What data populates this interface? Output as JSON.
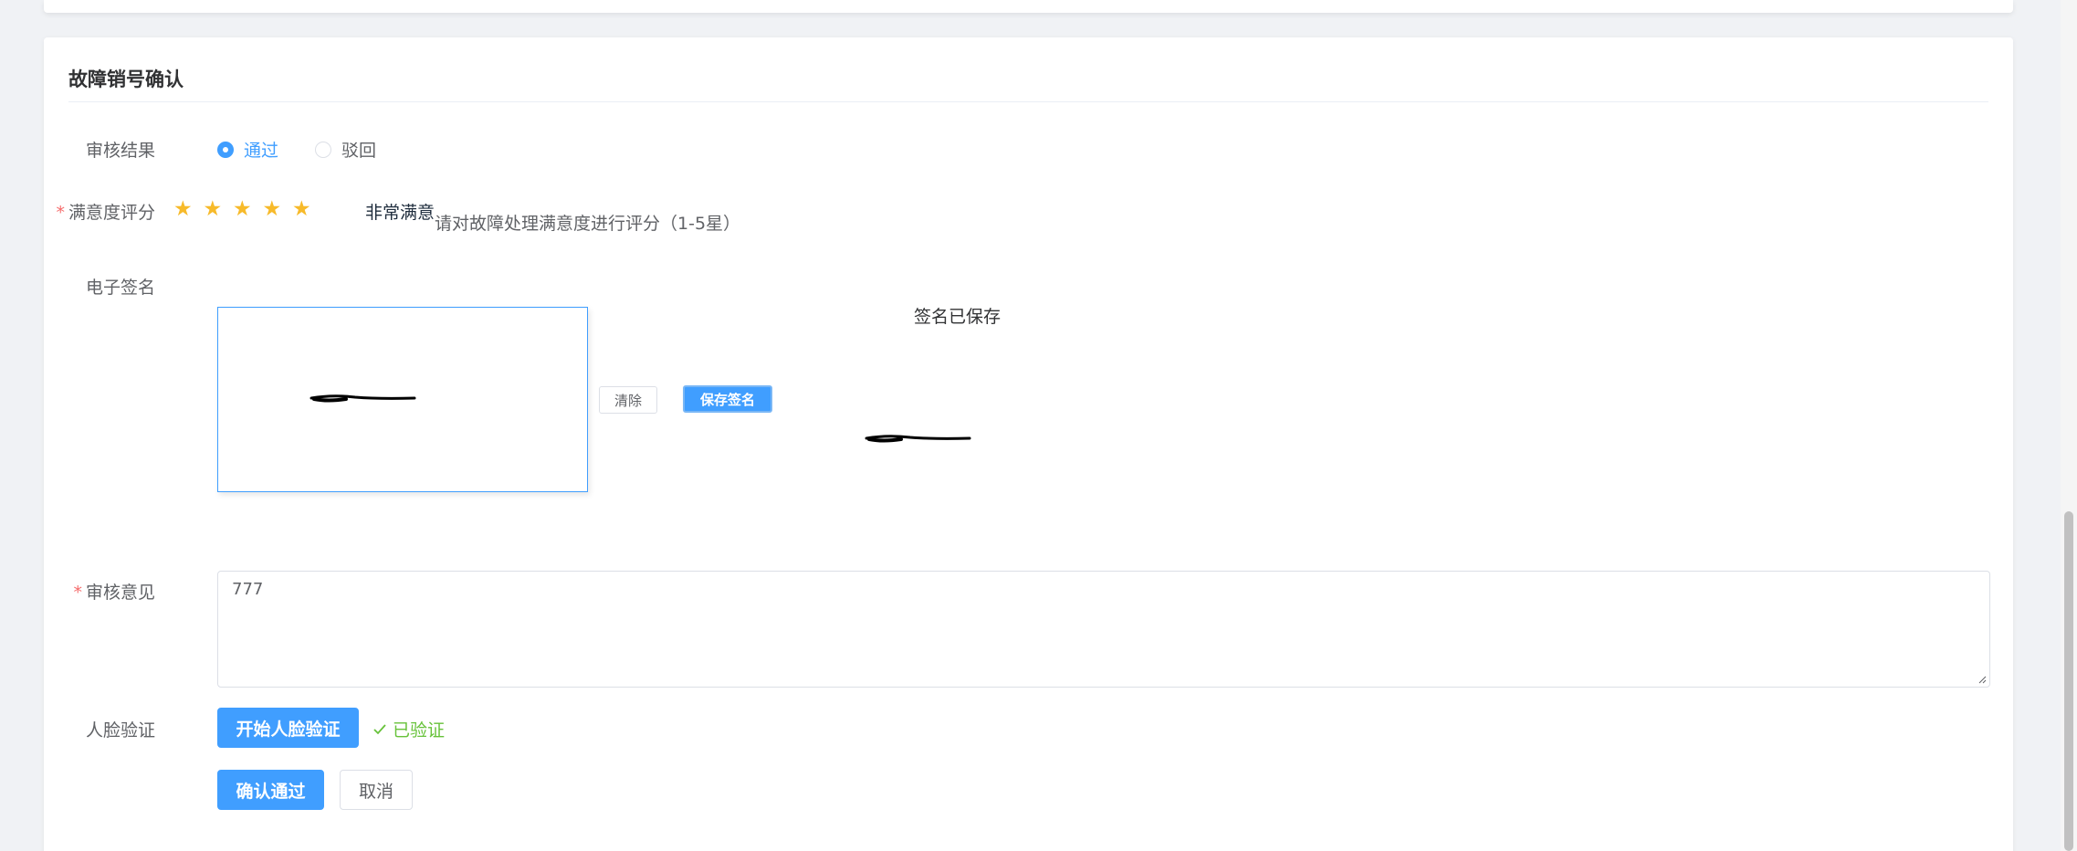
{
  "section": {
    "title": "故障销号确认"
  },
  "review_result": {
    "label": "审核结果",
    "options": [
      {
        "label": "通过",
        "selected": true
      },
      {
        "label": "驳回",
        "selected": false
      }
    ]
  },
  "satisfaction": {
    "label": "满意度评分",
    "required_mark": "*",
    "rating": 5,
    "max": 5,
    "rating_text": "非常满意",
    "hint": "请对故障处理满意度进行评分（1-5星）"
  },
  "signature": {
    "label": "电子签名",
    "clear_label": "清除",
    "save_label": "保存签名",
    "saved_label": "签名已保存"
  },
  "opinion": {
    "label": "审核意见",
    "required_mark": "*",
    "value": "777"
  },
  "face": {
    "label": "人脸验证",
    "button_label": "开始人脸验证",
    "status": "已验证"
  },
  "actions": {
    "confirm_label": "确认通过",
    "cancel_label": "取消"
  },
  "colors": {
    "primary": "#409eff",
    "success": "#67c23a",
    "danger": "#f56c6c",
    "star": "#f7ba2a"
  }
}
